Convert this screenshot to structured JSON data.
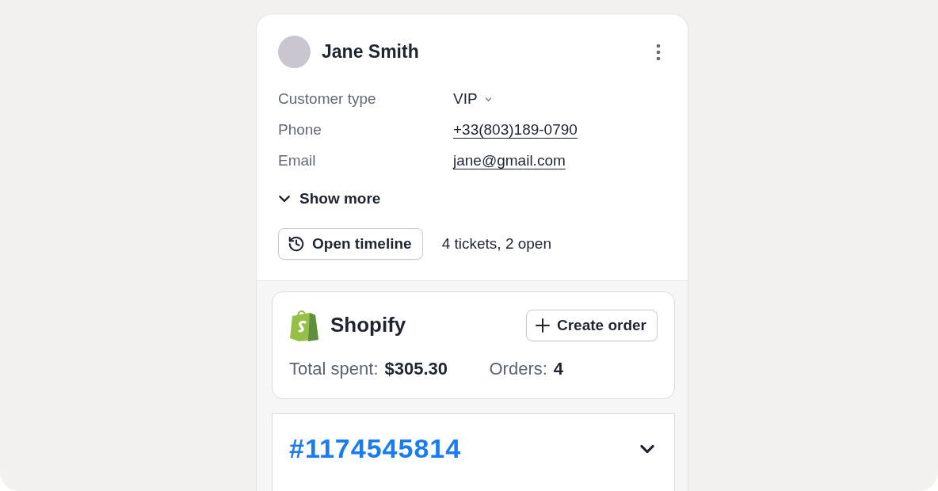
{
  "customer": {
    "name": "Jane Smith"
  },
  "fields": [
    {
      "kind": "select",
      "label": "Customer type",
      "value": "VIP"
    },
    {
      "kind": "link",
      "label": "Phone",
      "value": "+33(803)189-0790"
    },
    {
      "kind": "link",
      "label": "Email",
      "value": "jane@gmail.com"
    }
  ],
  "show_more": {
    "label": "Show more"
  },
  "timeline": {
    "button": "Open timeline",
    "summary": "4 tickets, 2 open"
  },
  "shopify": {
    "name": "Shopify",
    "button": "Create order",
    "stats": [
      {
        "label": "Total spent:",
        "value": "$305.30"
      },
      {
        "label": "Orders:",
        "value": "4"
      }
    ]
  },
  "order": {
    "number": "#1174545814"
  }
}
